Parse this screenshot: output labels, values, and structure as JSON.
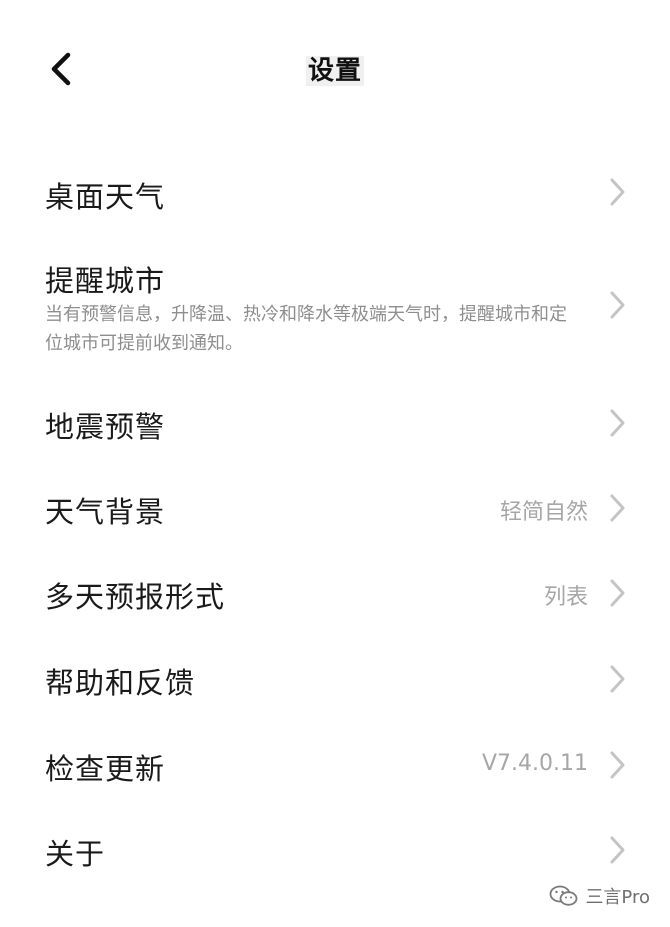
{
  "header": {
    "back_icon": "chevron-left-icon",
    "title": "设置"
  },
  "menu": {
    "items": [
      {
        "id": "desktop-weather",
        "title": "桌面天气",
        "value": "",
        "icon": "chevron-right-icon"
      },
      {
        "id": "alert-cities",
        "title": "提醒城市",
        "description": "当有预警信息，升降温、热冷和降水等极端天气时，提醒城市和定位城市可提前收到通知。",
        "value": "",
        "icon": "chevron-right-icon"
      },
      {
        "id": "earthquake-warning",
        "title": "地震预警",
        "value": "",
        "icon": "chevron-right-icon"
      },
      {
        "id": "weather-background",
        "title": "天气背景",
        "value": "轻简自然",
        "icon": "chevron-right-icon"
      },
      {
        "id": "forecast-format",
        "title": "多天预报形式",
        "value": "列表",
        "icon": "chevron-right-icon"
      },
      {
        "id": "help-feedback",
        "title": "帮助和反馈",
        "value": "",
        "icon": "chevron-right-icon"
      },
      {
        "id": "check-update",
        "title": "检查更新",
        "value": "V7.4.0.11",
        "icon": "chevron-right-icon"
      },
      {
        "id": "about",
        "title": "关于",
        "value": "",
        "icon": "chevron-right-icon"
      }
    ]
  },
  "watermark": {
    "icon": "wechat-icon",
    "text": "三言Pro"
  },
  "colors": {
    "background": "#ffffff",
    "title_text": "#1a1a1a",
    "secondary_text": "#8e8e8e",
    "value_text": "#a6a6a6",
    "chevron": "#c4c4c4"
  }
}
